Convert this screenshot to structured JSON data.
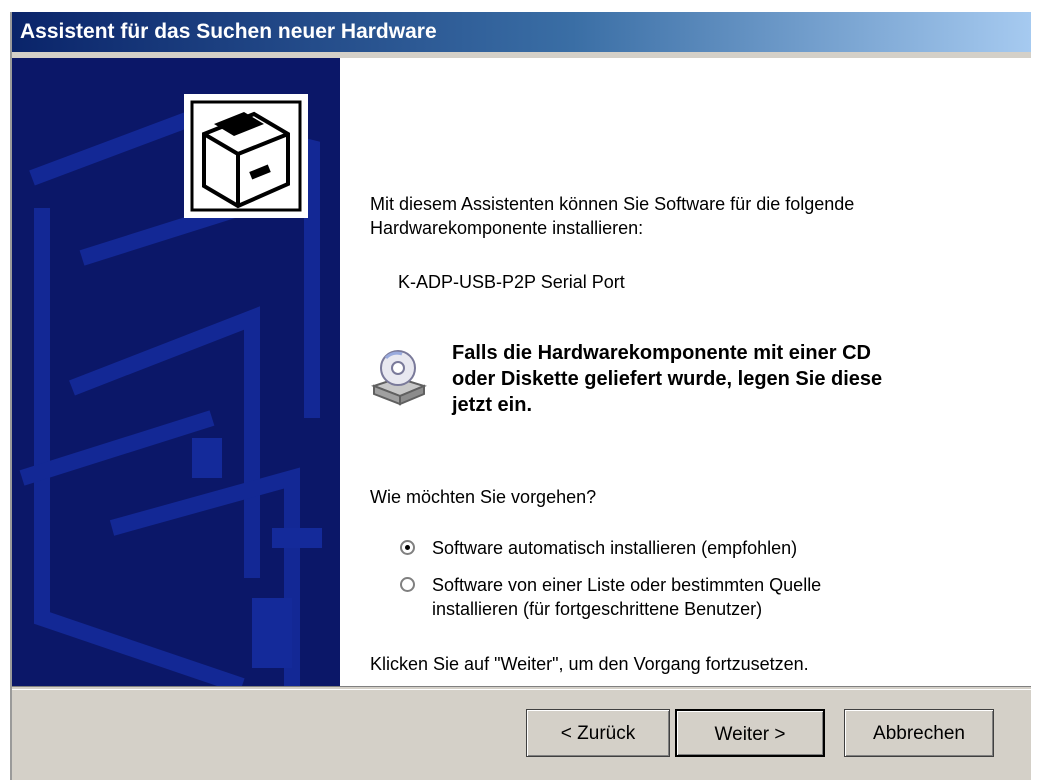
{
  "window": {
    "title": "Assistent für das Suchen neuer Hardware"
  },
  "intro": {
    "line1": "Mit diesem Assistenten können Sie Software für die folgende",
    "line2": "Hardwarekomponente installieren:"
  },
  "device_name": "K-ADP-USB-P2P Serial Port",
  "cd_notice": {
    "line1": "Falls die Hardwarekomponente mit einer CD",
    "line2": "oder Diskette geliefert wurde, legen Sie diese",
    "line3": "jetzt ein."
  },
  "question": "Wie möchten Sie vorgehen?",
  "options": [
    {
      "label": "Software automatisch installieren (empfohlen)",
      "checked": true
    },
    {
      "label_line1": "Software von einer Liste oder bestimmten Quelle",
      "label_line2": "installieren (für fortgeschrittene Benutzer)",
      "checked": false
    }
  ],
  "instruction": "Klicken Sie auf \"Weiter\", um den Vorgang fortzusetzen.",
  "buttons": {
    "back": "< Zurück",
    "next": "Weiter >",
    "cancel": "Abbrechen"
  },
  "colors": {
    "banner": "#0b1768",
    "title_start": "#0a246a",
    "title_end": "#a6caf0",
    "dialog_face": "#d4d0c8"
  },
  "icons": [
    "hardware-board-icon",
    "cd-drive-icon"
  ]
}
